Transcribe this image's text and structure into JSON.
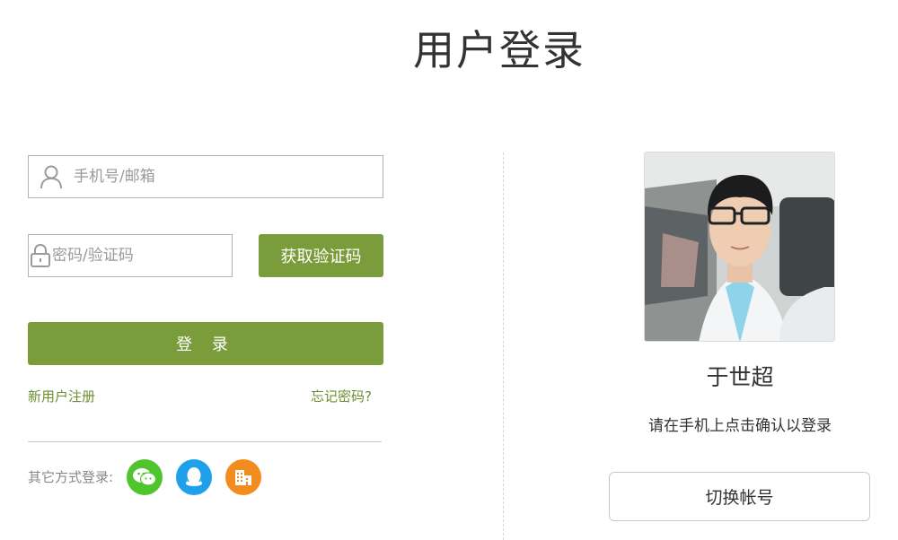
{
  "page": {
    "title": "用户登录"
  },
  "form": {
    "account_placeholder": "手机号/邮箱",
    "account_icon": "user-icon",
    "password_placeholder": "密码/验证码",
    "password_icon": "lock-icon",
    "get_code_label": "获取验证码",
    "login_label": "登 录",
    "register_link": "新用户注册",
    "forgot_link": "忘记密码?",
    "other_methods_label": "其它方式登录:",
    "social_icons": [
      "wechat-icon",
      "qq-icon",
      "organization-icon"
    ]
  },
  "quick_login": {
    "user_name": "于世超",
    "tip": "请在手机上点击确认以登录",
    "switch_label": "切换帐号"
  },
  "colors": {
    "primary": "#7a9c3a",
    "link": "#6d8e2f",
    "wechat": "#4fc42c",
    "qq": "#1fa0ea",
    "org": "#f28c1f"
  }
}
